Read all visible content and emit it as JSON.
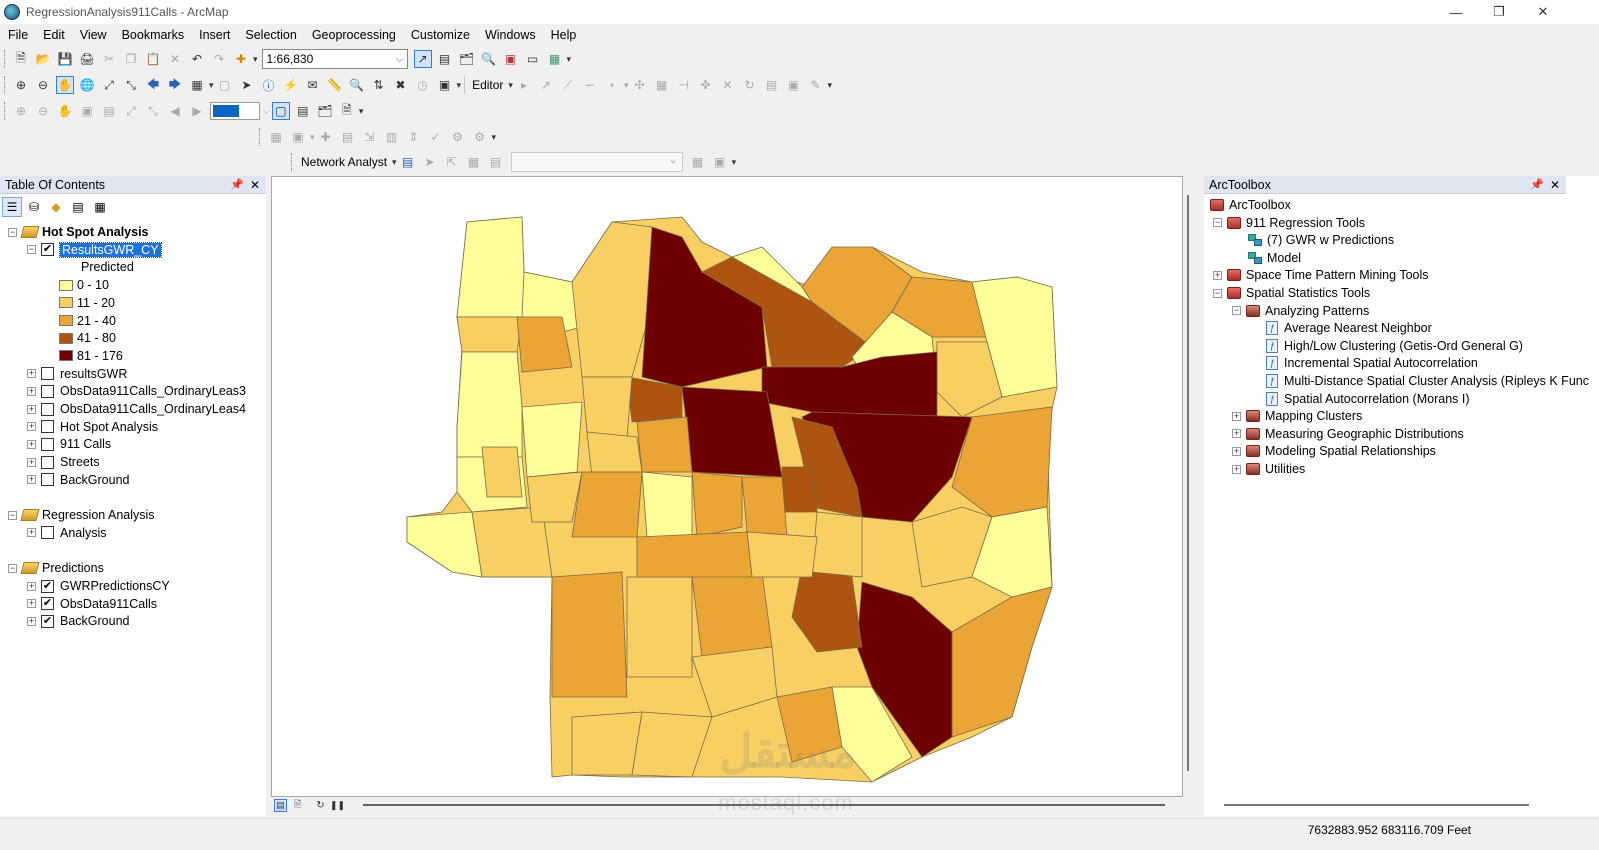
{
  "window": {
    "title": "RegressionAnalysis911Calls - ArcMap",
    "minimize_icon": "minimize-icon",
    "maximize_icon": "restore-icon",
    "close_icon": "close-icon"
  },
  "menu": [
    "File",
    "Edit",
    "View",
    "Bookmarks",
    "Insert",
    "Selection",
    "Geoprocessing",
    "Customize",
    "Windows",
    "Help"
  ],
  "toolbar": {
    "scale_value": "1:66,830",
    "editor_label": "Editor",
    "network_analyst_label": "Network Analyst"
  },
  "toc": {
    "header": "Table Of Contents",
    "groups": [
      {
        "name": "Hot Spot Analysis",
        "layers": [
          {
            "name": "ResultsGWR_CY",
            "checked": true,
            "selected": true,
            "legend_title": "Predicted",
            "classes": [
              {
                "label": "0 - 10",
                "color": "#ffff9a"
              },
              {
                "label": "11 - 20",
                "color": "#f7cf62"
              },
              {
                "label": "21 - 40",
                "color": "#eba436"
              },
              {
                "label": "41 - 80",
                "color": "#ad5510"
              },
              {
                "label": "81 - 176",
                "color": "#6d0000"
              }
            ]
          },
          {
            "name": "resultsGWR",
            "checked": false
          },
          {
            "name": "ObsData911Calls_OrdinaryLeas3",
            "checked": false
          },
          {
            "name": "ObsData911Calls_OrdinaryLeas4",
            "checked": false
          },
          {
            "name": "Hot Spot Analysis",
            "checked": false
          },
          {
            "name": "911 Calls",
            "checked": false
          },
          {
            "name": "Streets",
            "checked": false
          },
          {
            "name": "BackGround",
            "checked": false
          }
        ]
      },
      {
        "name": "Regression Analysis",
        "layers": [
          {
            "name": "Analysis",
            "checked": false
          }
        ]
      },
      {
        "name": "Predictions",
        "layers": [
          {
            "name": "GWRPredictionsCY",
            "checked": true
          },
          {
            "name": "ObsData911Calls",
            "checked": true
          },
          {
            "name": "BackGround",
            "checked": true
          }
        ]
      }
    ]
  },
  "toolbox": {
    "header": "ArcToolbox",
    "root": "ArcToolbox",
    "items": [
      {
        "label": "911 Regression Tools",
        "kind": "toolbox",
        "level": 1,
        "expanded": true
      },
      {
        "label": "(7) GWR w Predictions",
        "kind": "model",
        "level": 2
      },
      {
        "label": "Model",
        "kind": "model",
        "level": 2
      },
      {
        "label": "Space Time Pattern Mining Tools",
        "kind": "toolbox",
        "level": 1,
        "expanded": false
      },
      {
        "label": "Spatial Statistics Tools",
        "kind": "toolbox",
        "level": 1,
        "expanded": true
      },
      {
        "label": "Analyzing Patterns",
        "kind": "toolset",
        "level": 2,
        "expanded": true
      },
      {
        "label": "Average Nearest Neighbor",
        "kind": "tool",
        "level": 3
      },
      {
        "label": "High/Low Clustering (Getis-Ord General G)",
        "kind": "tool",
        "level": 3
      },
      {
        "label": "Incremental Spatial Autocorrelation",
        "kind": "tool",
        "level": 3
      },
      {
        "label": "Multi-Distance Spatial Cluster Analysis (Ripleys K Func",
        "kind": "tool",
        "level": 3
      },
      {
        "label": "Spatial Autocorrelation (Morans I)",
        "kind": "tool",
        "level": 3
      },
      {
        "label": "Mapping Clusters",
        "kind": "toolset",
        "level": 2,
        "expanded": false
      },
      {
        "label": "Measuring Geographic Distributions",
        "kind": "toolset",
        "level": 2,
        "expanded": false
      },
      {
        "label": "Modeling Spatial Relationships",
        "kind": "toolset",
        "level": 2,
        "expanded": false
      },
      {
        "label": "Utilities",
        "kind": "toolset",
        "level": 2,
        "expanded": false
      }
    ]
  },
  "status": {
    "coordinates": "7632883.952  683116.709 Feet"
  },
  "watermark": {
    "main": "مستقل",
    "sub": "mostaql.com"
  }
}
